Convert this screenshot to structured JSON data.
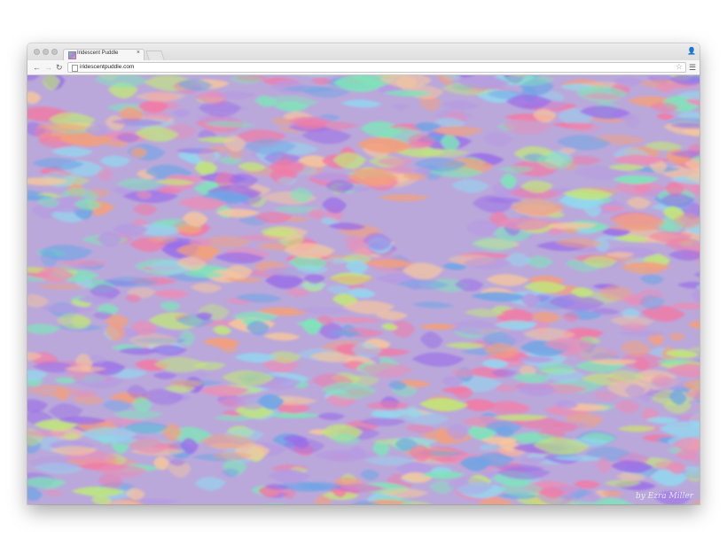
{
  "browser": {
    "tab_title": "Iridescent Puddle",
    "tab_close": "×",
    "url": "iridescentpuddle.com",
    "icons": {
      "back": "back-arrow-icon",
      "forward": "forward-arrow-icon",
      "reload": "reload-icon",
      "star": "bookmark-star-icon",
      "menu": "hamburger-menu-icon",
      "profile": "profile-icon",
      "page": "page-icon"
    }
  },
  "page": {
    "credit": "by Ezra Miller",
    "palette": [
      "#e88fb8",
      "#b69be2",
      "#7ee6b9",
      "#f3a07c",
      "#93d7ef",
      "#c2e779",
      "#9a6ee8",
      "#f6c79d",
      "#6fa5e6",
      "#f27aa5"
    ]
  }
}
